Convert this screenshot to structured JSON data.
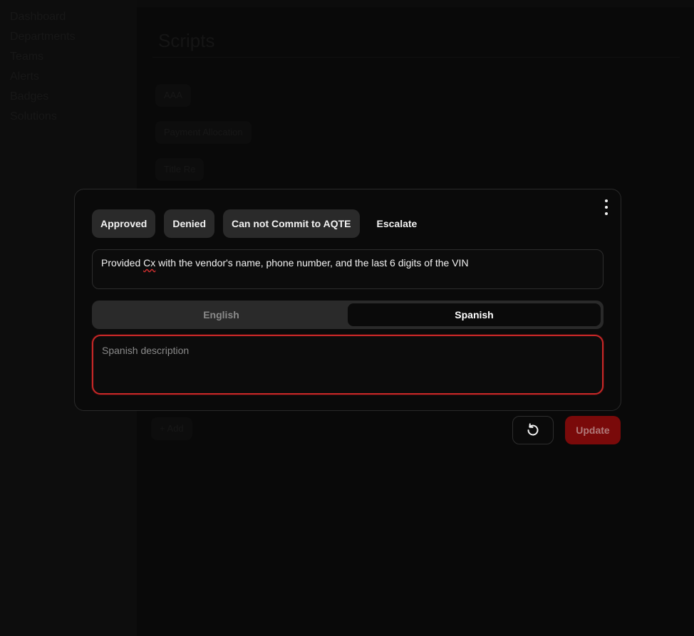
{
  "background": {
    "sidebar": {
      "items": [
        {
          "label": "Dashboard"
        },
        {
          "label": "Departments"
        },
        {
          "label": "Teams"
        },
        {
          "label": "Alerts"
        },
        {
          "label": "Badges"
        },
        {
          "label": "Solutions"
        }
      ]
    },
    "page_title": "Scripts",
    "chips": [
      "AAA",
      "Payment Allocation",
      "Title Re"
    ],
    "add_label": "+ Add"
  },
  "modal": {
    "status_buttons": [
      {
        "label": "Approved"
      },
      {
        "label": "Denied"
      },
      {
        "label": "Can not Commit to AQTE"
      },
      {
        "label": "Escalate"
      }
    ],
    "description": {
      "prefix": "Provided ",
      "misspelled": "Cx",
      "suffix": " with the vendor's name, phone number, and the last 6 digits of the VIN"
    },
    "language_tabs": {
      "english": "English",
      "spanish": "Spanish",
      "active": "Spanish"
    },
    "spanish_field": {
      "placeholder": "Spanish description",
      "value": ""
    },
    "kebab_icon": "more-vertical-icon"
  },
  "actions": {
    "reset_icon": "reset-icon",
    "update_label": "Update"
  },
  "colors": {
    "accent_red": "#c62828",
    "update_bg": "#7a0a0a",
    "chip_bg": "#2a2a2a"
  }
}
